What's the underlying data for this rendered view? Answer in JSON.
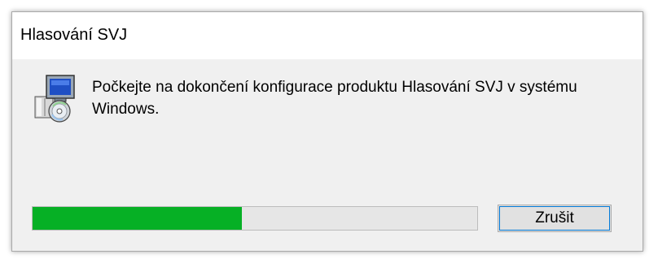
{
  "window": {
    "title": "Hlasování SVJ"
  },
  "dialog": {
    "icon": "windows-installer-icon",
    "message": "Počkejte na dokončení konfigurace produktu Hlasování SVJ v systému Windows."
  },
  "progress": {
    "fraction": 0.47,
    "fill_color": "#06b025",
    "track_color": "#e6e6e6"
  },
  "buttons": {
    "cancel_label": "Zrušit"
  },
  "colors": {
    "accent": "#0078d7",
    "dialog_background": "#f0f0f0"
  }
}
